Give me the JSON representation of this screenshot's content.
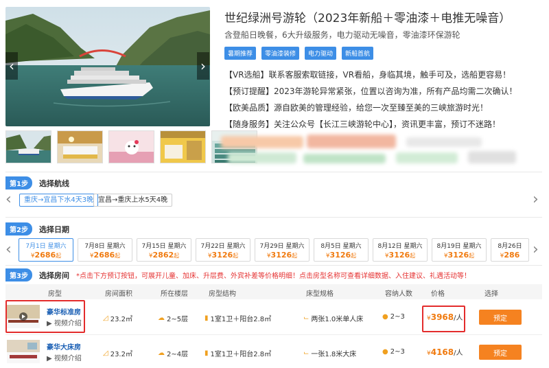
{
  "product": {
    "title": "世纪绿洲号游轮（2023年新船＋零油漆＋电推无噪音）",
    "subtitle": "含登船日晚餐，6大升级服务，电力驱动无噪音，零油漆环保游轮",
    "tags": [
      "暑期推荐",
      "零油漆装修",
      "电力驱动",
      "新船首航"
    ],
    "features": [
      "【VR选船】联系客服索取链接，VR看船，身临其境，触手可及，选船更容易！",
      "【预订提醒】2023年游轮异常紧张，位置以咨询为准，所有产品均需二次确认！",
      "【欧美品质】源自欧美的管理经验，给您一次至臻至美的三峡旅游时光！",
      "【随身服务】关注公众号【长江三峡游轮中心】，资讯更丰富，预订不迷路！"
    ]
  },
  "gallery": {
    "prev_icon": "‹",
    "next_icon": "›"
  },
  "step1": {
    "badge": "第1步",
    "label": "选择航线"
  },
  "routes": [
    {
      "label": "重庆→宜昌下水4天3晚",
      "active": true
    },
    {
      "label": "宜昌→重庆上水5天4晚",
      "active": false
    }
  ],
  "step2": {
    "badge": "第2步",
    "label": "选择日期"
  },
  "currency": "¥",
  "qi": "起",
  "dates": [
    {
      "label": "7月1日 星期六",
      "price": "2686",
      "active": true
    },
    {
      "label": "7月8日 星期六",
      "price": "2686",
      "active": false
    },
    {
      "label": "7月15日 星期六",
      "price": "2862",
      "active": false
    },
    {
      "label": "7月22日 星期六",
      "price": "3126",
      "active": false
    },
    {
      "label": "7月29日 星期六",
      "price": "3126",
      "active": false
    },
    {
      "label": "8月5日 星期六",
      "price": "3126",
      "active": false
    },
    {
      "label": "8月12日 星期六",
      "price": "3126",
      "active": false
    },
    {
      "label": "8月19日 星期六",
      "price": "3126",
      "active": false
    },
    {
      "label": "8月26日",
      "price": "286",
      "active": false
    }
  ],
  "step3": {
    "badge": "第3步",
    "label": "选择房间",
    "note": "*点击下方预订按钮，可展开儿童、加床、升层费、外宾补差等价格明细！点击房型名称可查看详细数据、入住建议、礼遇活动等！"
  },
  "table": {
    "headers": [
      "房型",
      "房间面积",
      "所在楼层",
      "房型结构",
      "床型规格",
      "容纳人数",
      "价格",
      "选择"
    ]
  },
  "rooms": [
    {
      "name": "豪华标准房",
      "video": "视频介绍",
      "area": "23.2㎡",
      "floor": "2~5层",
      "structure": "1室1卫＋阳台2.8㎡",
      "bed": "两张1.0米单人床",
      "capacity": "2~3",
      "price": "3968",
      "per": "/人",
      "book": "预定"
    },
    {
      "name": "豪华大床房",
      "video": "视频介绍",
      "area": "23.2㎡",
      "floor": "2~4层",
      "structure": "1室1卫＋阳台2.8㎡",
      "bed": "一张1.8米大床",
      "capacity": "2~3",
      "price": "4168",
      "per": "/人",
      "book": "预定"
    }
  ],
  "colors": {
    "accent": "#3d8ee6",
    "price": "#f07a0f",
    "button": "#f58220",
    "highlight": "#e32b2b"
  }
}
